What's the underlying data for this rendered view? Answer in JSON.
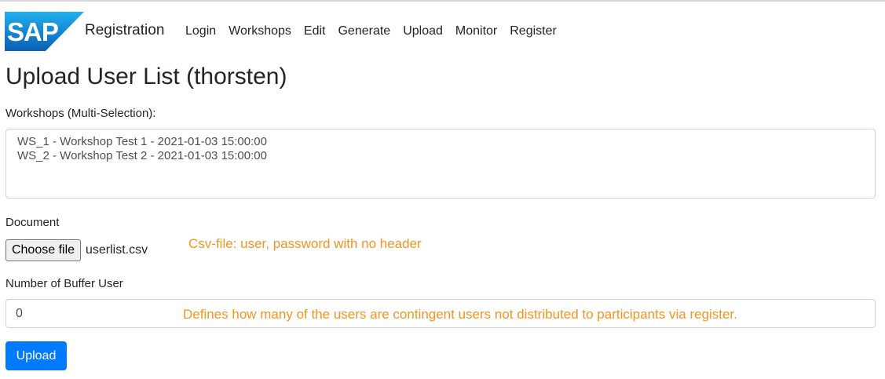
{
  "nav": {
    "logo_text": "SAP",
    "brand": "Registration",
    "links": [
      "Login",
      "Workshops",
      "Edit",
      "Generate",
      "Upload",
      "Monitor",
      "Register"
    ]
  },
  "page": {
    "title": "Upload User List (thorsten)"
  },
  "form": {
    "workshops_label": "Workshops (Multi-Selection):",
    "workshop_options": [
      "WS_1 - Workshop Test 1 - 2021-01-03 15:00:00",
      "WS_2 - Workshop Test 2 - 2021-01-03 15:00:00"
    ],
    "document_label": "Document",
    "choose_file_label": "Choose file",
    "file_name": "userlist.csv",
    "document_hint": "Csv-file: user, password with no header",
    "buffer_label": "Number of Buffer User",
    "buffer_value": "0",
    "buffer_hint": "Defines how many of the users are contingent users not distributed to participants via register.",
    "upload_label": "Upload"
  },
  "colors": {
    "sap_blue": "#1a73c9",
    "hint_orange": "#f7931e",
    "primary": "#007bff"
  }
}
